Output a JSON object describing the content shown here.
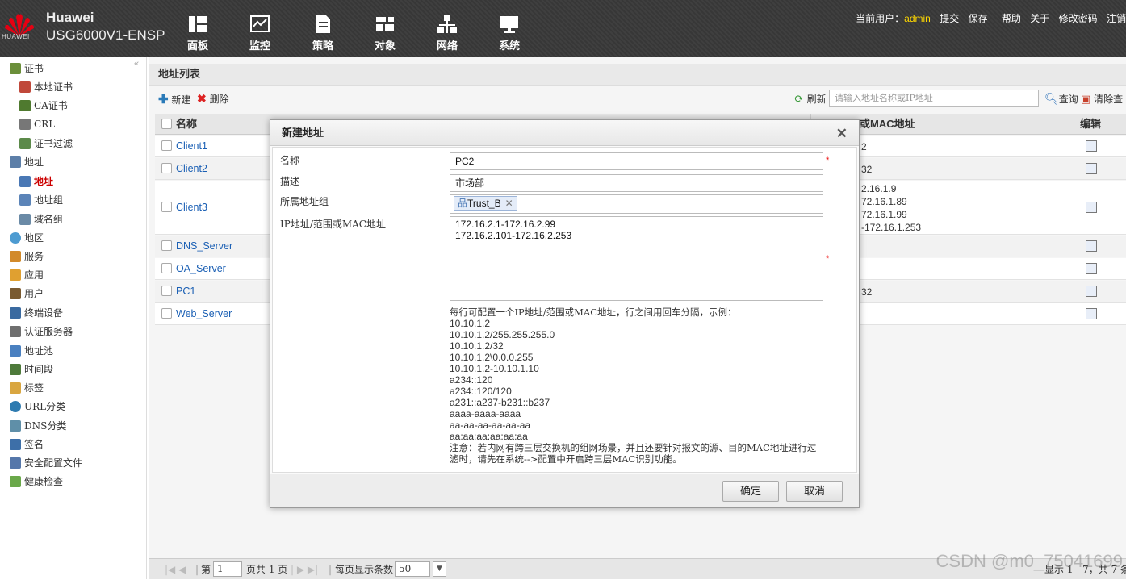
{
  "header": {
    "brand": "Huawei",
    "model": "USG6000V1-ENSP",
    "logo_text": "HUAWEI",
    "nav": [
      {
        "label": "面板",
        "icon": "dashboard-icon"
      },
      {
        "label": "监控",
        "icon": "monitor-chart-icon"
      },
      {
        "label": "策略",
        "icon": "policy-doc-icon"
      },
      {
        "label": "对象",
        "icon": "object-icon"
      },
      {
        "label": "网络",
        "icon": "network-icon"
      },
      {
        "label": "系统",
        "icon": "system-monitor-icon"
      }
    ],
    "user_label": "当前用户：",
    "user_name": "admin",
    "links": [
      "提交",
      "保存",
      "帮助",
      "关于",
      "修改密码",
      "注销"
    ]
  },
  "sidebar": {
    "items": [
      {
        "label": "证书",
        "icon": "certificate-icon"
      },
      {
        "label": "本地证书",
        "icon": "local-cert-icon"
      },
      {
        "label": "CA证书",
        "icon": "ca-cert-icon"
      },
      {
        "label": "CRL",
        "icon": "crl-icon"
      },
      {
        "label": "证书过滤",
        "icon": "cert-filter-icon"
      },
      {
        "label": "地址",
        "icon": "address-icon"
      },
      {
        "label": "地址",
        "icon": "address-icon"
      },
      {
        "label": "地址组",
        "icon": "address-group-icon"
      },
      {
        "label": "域名组",
        "icon": "domain-group-icon"
      },
      {
        "label": "地区",
        "icon": "region-globe-icon"
      },
      {
        "label": "服务",
        "icon": "service-icon"
      },
      {
        "label": "应用",
        "icon": "application-icon"
      },
      {
        "label": "用户",
        "icon": "user-icon"
      },
      {
        "label": "终端设备",
        "icon": "terminal-device-icon"
      },
      {
        "label": "认证服务器",
        "icon": "auth-server-icon"
      },
      {
        "label": "地址池",
        "icon": "address-pool-icon"
      },
      {
        "label": "时间段",
        "icon": "time-range-icon"
      },
      {
        "label": "标签",
        "icon": "tag-icon"
      },
      {
        "label": "URL分类",
        "icon": "url-category-icon"
      },
      {
        "label": "DNS分类",
        "icon": "dns-category-icon"
      },
      {
        "label": "签名",
        "icon": "signature-icon"
      },
      {
        "label": "安全配置文件",
        "icon": "security-profile-icon"
      },
      {
        "label": "健康检查",
        "icon": "health-check-icon"
      }
    ],
    "active_index": 6
  },
  "list": {
    "title": "地址列表",
    "new_label": "新建",
    "delete_label": "删除",
    "refresh_label": "刷新",
    "search_placeholder": "请输入地址名称或IP地址",
    "query_label": "查询",
    "clear_label": "清除查",
    "col_name": "名称",
    "col_mac": "或MAC地址",
    "col_edit": "编辑",
    "rows": [
      {
        "name": "Client1",
        "mac": "2"
      },
      {
        "name": "Client2",
        "mac": "32"
      },
      {
        "name": "Client3",
        "mac": "2.16.1.9\n72.16.1.89\n72.16.1.99\n-172.16.1.253"
      },
      {
        "name": "DNS_Server",
        "mac": ""
      },
      {
        "name": "OA_Server",
        "mac": ""
      },
      {
        "name": "PC1",
        "mac": "32"
      },
      {
        "name": "Web_Server",
        "mac": ""
      }
    ]
  },
  "pager": {
    "page_label": "第",
    "page_value": "1",
    "total_label": "页共 1 页",
    "per_page_label": "每页显示条数",
    "per_page_value": "50",
    "summary": "显示 1 - 7，共 7 条"
  },
  "modal": {
    "title": "新建地址",
    "name_label": "名称",
    "name_value": "PC2",
    "desc_label": "描述",
    "desc_value": "市场部",
    "group_label": "所属地址组",
    "group_tag": "Trust_B",
    "ip_label": "IP地址/范围或MAC地址",
    "ip_value": "172.16.2.1-172.16.2.99\n172.16.2.101-172.16.2.253",
    "help_intro": "每行可配置一个IP地址/范围或MAC地址，行之间用回车分隔，示例：",
    "help_examples": [
      "10.10.1.2",
      "10.10.1.2/255.255.255.0",
      "10.10.1.2/32",
      "10.10.1.2\\0.0.0.255",
      "10.10.1.2-10.10.1.10",
      "a234::120",
      "a234::120/120",
      "a231::a237-b231::b237",
      "aaaa-aaaa-aaaa",
      "aa-aa-aa-aa-aa-aa",
      "aa:aa:aa:aa:aa:aa"
    ],
    "help_note_1": "注意：若内网有跨三层交换机的组网场景，并且还要针对报文的源、目的MAC地址进行过",
    "help_note_2": "滤时，请先在系统-->配置中开启跨三层MAC识别功能。",
    "ok_label": "确定",
    "cancel_label": "取消"
  },
  "watermark": "CSDN @m0_75041699",
  "colors": {
    "brand_red": "#e60012",
    "active": "#cc0000",
    "link": "#1a5fb4",
    "user": "#ffd800"
  }
}
